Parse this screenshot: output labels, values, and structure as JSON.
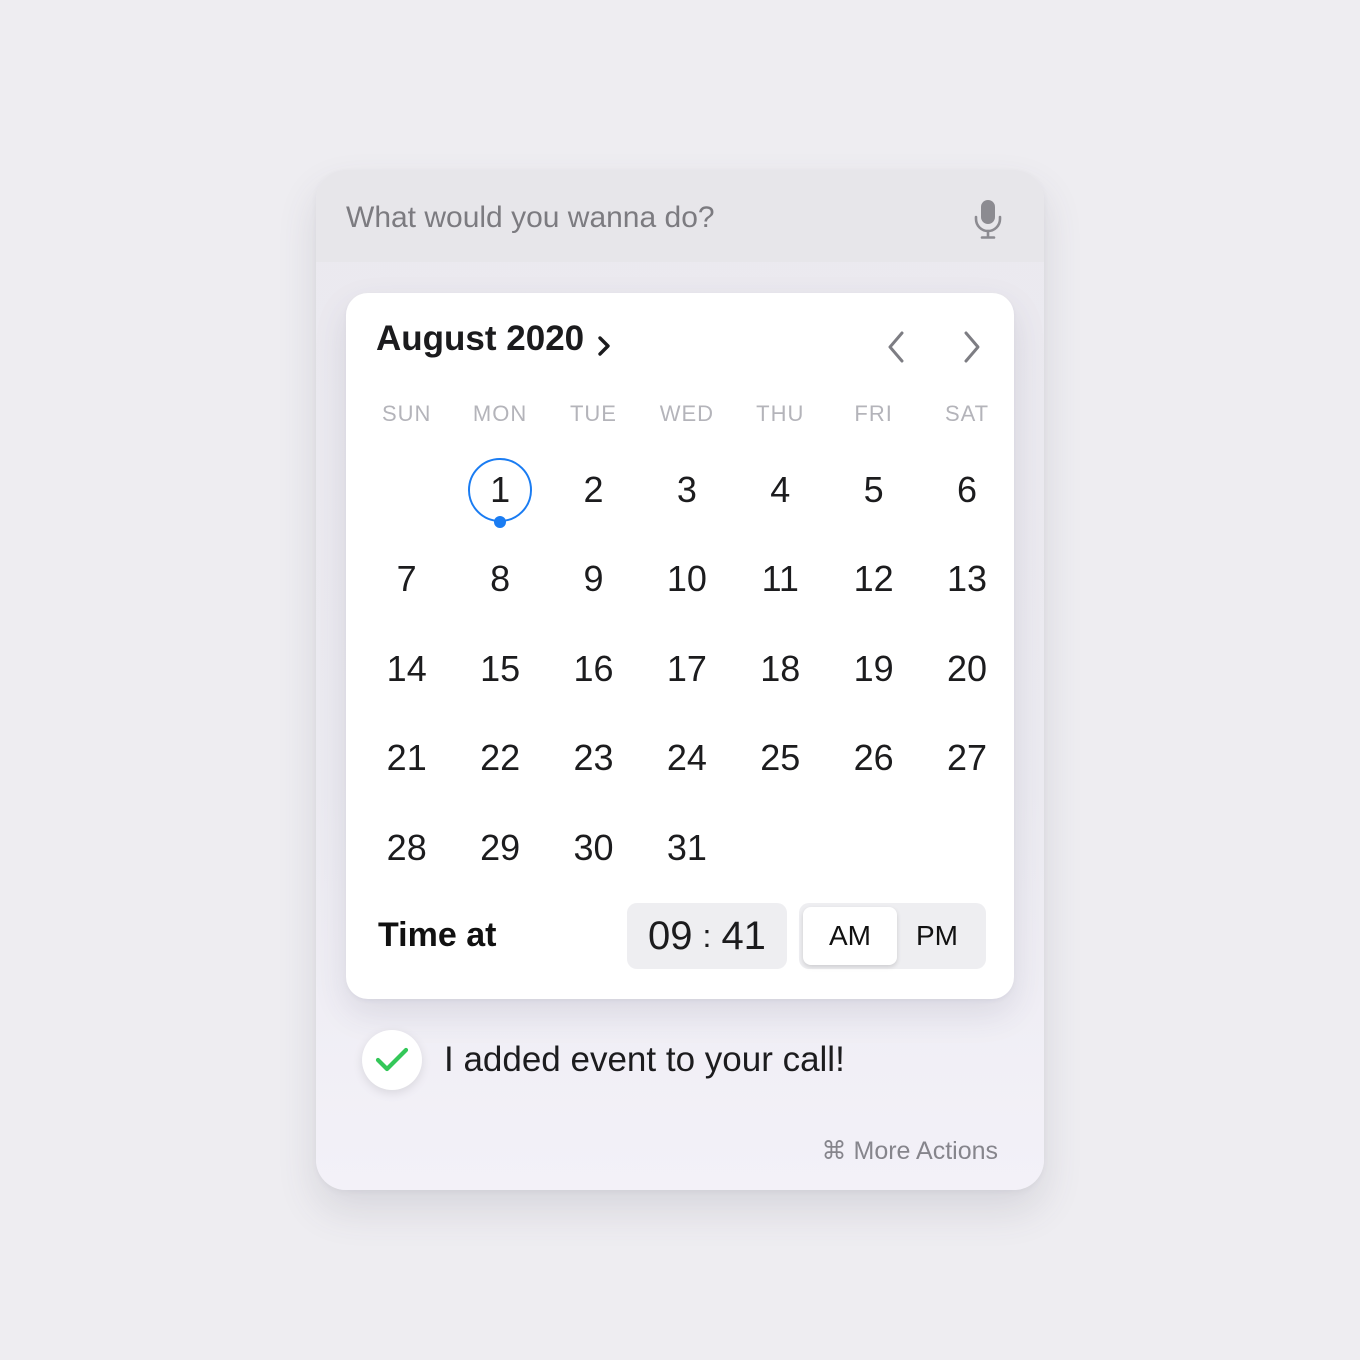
{
  "search": {
    "placeholder": "What would you wanna do?"
  },
  "calendar": {
    "month_label": "August 2020",
    "weekdays": [
      "SUN",
      "MON",
      "TUE",
      "WED",
      "THU",
      "FRI",
      "SAT"
    ],
    "days": [
      [
        null,
        1,
        2,
        3,
        4,
        5,
        6
      ],
      [
        7,
        8,
        9,
        10,
        11,
        12,
        13
      ],
      [
        14,
        15,
        16,
        17,
        18,
        19,
        20
      ],
      [
        21,
        22,
        23,
        24,
        25,
        26,
        27
      ],
      [
        28,
        29,
        30,
        31,
        null,
        null,
        null
      ]
    ],
    "selected_day": 1
  },
  "time": {
    "label": "Time at",
    "hour": "09",
    "separator": ":",
    "minute": "41",
    "am_label": "AM",
    "pm_label": "PM",
    "selected_period": "AM"
  },
  "confirmation": {
    "text": "I added event to your call!"
  },
  "footer": {
    "more_actions": "⌘ More Actions"
  },
  "colors": {
    "accent": "#1a7cf2",
    "success": "#34c759"
  },
  "icons": [
    "microphone-icon",
    "chevron-right-icon",
    "chevron-left-icon",
    "checkmark-icon"
  ]
}
